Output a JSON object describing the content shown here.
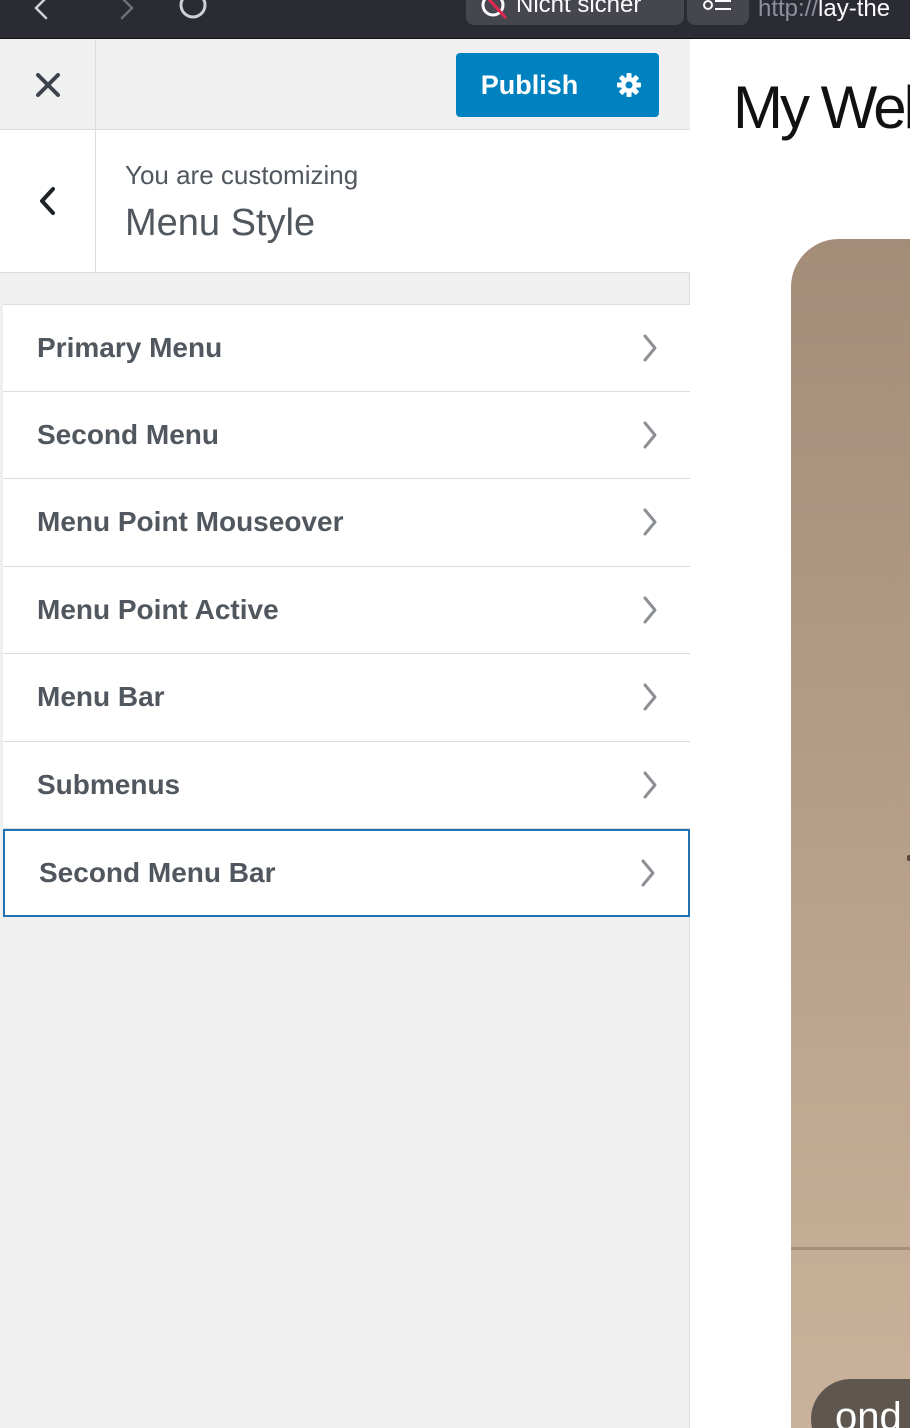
{
  "browser": {
    "security_label": "Nicht sicher",
    "url_scheme": "http://",
    "url_host": "lay-the"
  },
  "header": {
    "publish_label": "Publish"
  },
  "section": {
    "customizing_label": "You are customizing",
    "title": "Menu Style"
  },
  "menu_items": [
    {
      "label": "Primary Menu"
    },
    {
      "label": "Second Menu"
    },
    {
      "label": "Menu Point Mouseover"
    },
    {
      "label": "Menu Point Active"
    },
    {
      "label": "Menu Bar"
    },
    {
      "label": "Submenus"
    },
    {
      "label": "Second Menu Bar",
      "focused": true
    }
  ],
  "preview": {
    "site_title": "My Web",
    "pill_text": "ond"
  },
  "colors": {
    "accent": "#0081c0",
    "focus": "#2271b1",
    "panel_bg": "#f0f0f1",
    "text": "#50575e"
  }
}
